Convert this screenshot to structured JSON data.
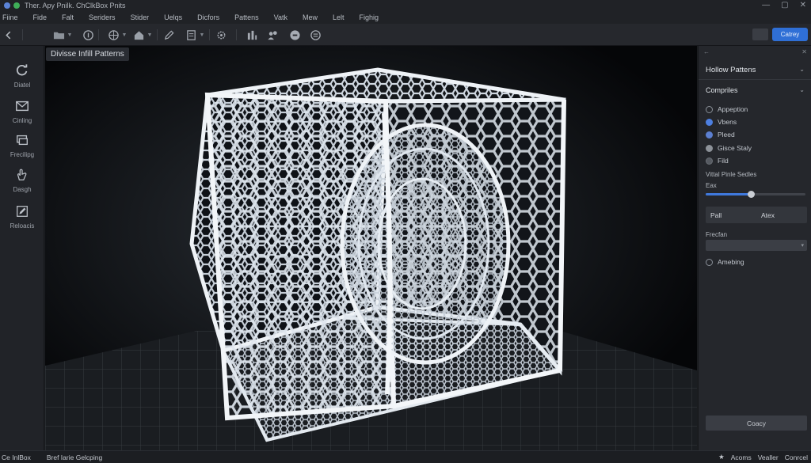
{
  "window": {
    "title": "Ther. Apy Pnilk. ChClkBox Pnits"
  },
  "menu": [
    "Fiine",
    "Fide",
    "Falt",
    "Seriders",
    "Stider",
    "Uelqs",
    "Dicfors",
    "Pattens",
    "Vatk",
    "Mew",
    "Lelt",
    "Fighig"
  ],
  "toolbar": {
    "primary_button": "Catrey"
  },
  "sidebar": {
    "items": [
      {
        "label": "Diatel",
        "icon": "refresh-icon"
      },
      {
        "label": "Cinling",
        "icon": "mail-icon"
      },
      {
        "label": "Frecilipg",
        "icon": "layers-icon"
      },
      {
        "label": "Dasgh",
        "icon": "hand-icon"
      },
      {
        "label": "Reloacis",
        "icon": "edit-icon"
      }
    ]
  },
  "viewport": {
    "label": "Divisse Infill Patterns"
  },
  "panel": {
    "title": "Hollow Pattens",
    "section": "Compriles",
    "options": [
      {
        "label": "Appeption",
        "style": "empty"
      },
      {
        "label": "Vbens",
        "style": "blue"
      },
      {
        "label": "Pleed",
        "style": "blue2"
      },
      {
        "label": "Gisce Staly",
        "style": "grey"
      },
      {
        "label": "Fild",
        "style": "dark"
      }
    ],
    "slider_label": "Vittal Pinle Sedles",
    "slider_sublabel": "Eax",
    "slider_value": 0.45,
    "segment": [
      "Pall",
      "Atex"
    ],
    "select_label": "Frecfan",
    "option_after": "Amebing",
    "button": "Coacy"
  },
  "status": {
    "left1": "Ce InlBox",
    "left2": "Bref Iarie Gelcping",
    "right": [
      "Acoms",
      "Vealler",
      "Conrcel"
    ]
  }
}
